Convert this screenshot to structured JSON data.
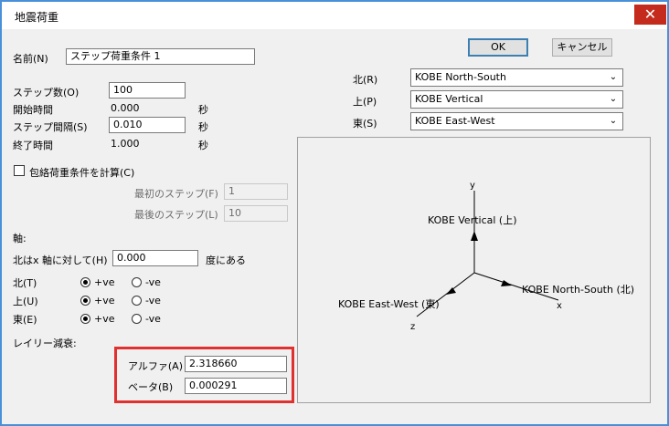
{
  "window": {
    "title": "地震荷重",
    "close_glyph": "✕"
  },
  "buttons": {
    "ok": "OK",
    "cancel": "キャンセル"
  },
  "name": {
    "label": "名前(N)",
    "value": "ステップ荷重条件 1"
  },
  "steps": {
    "count_label": "ステップ数(O)",
    "count_value": "100",
    "start_label": "開始時間",
    "start_value": "0.000",
    "start_unit": "秒",
    "interval_label": "ステップ間隔(S)",
    "interval_value": "0.010",
    "interval_unit": "秒",
    "end_label": "終了時間",
    "end_value": "1.000",
    "end_unit": "秒"
  },
  "envelope": {
    "label": "包絡荷重条件を計算(C)",
    "first_label": "最初のステップ(F)",
    "first_value": "1",
    "last_label": "最後のステップ(L)",
    "last_value": "10"
  },
  "axis": {
    "heading": "軸:",
    "angle_prefix": "北はx 軸に対して(H)",
    "angle_value": "0.000",
    "angle_suffix": "度にある",
    "north_label": "北(T)",
    "up_label": "上(U)",
    "east_label": "東(E)",
    "plus": "+ve",
    "minus": "-ve"
  },
  "rayleigh": {
    "heading": "レイリー減衰:",
    "alpha_label": "アルファ(A)",
    "alpha_value": "2.318660",
    "beta_label": "ベータ(B)",
    "beta_value": "0.000291"
  },
  "directions": {
    "north_label": "北(R)",
    "north_value": "KOBE North-South",
    "up_label": "上(P)",
    "up_value": "KOBE Vertical",
    "east_label": "東(S)",
    "east_value": "KOBE East-West"
  },
  "diagram": {
    "y_axis": "y",
    "x_axis": "x",
    "z_axis": "z",
    "vertical_label": "KOBE Vertical (上)",
    "ns_label": "KOBE North-South (北)",
    "ew_label": "KOBE East-West (東)"
  }
}
